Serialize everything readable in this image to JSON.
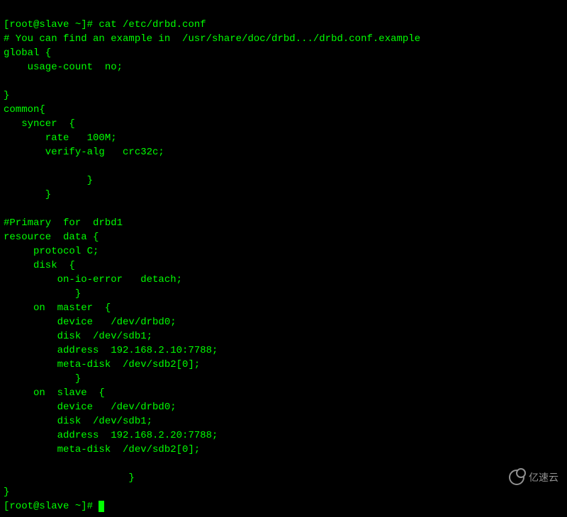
{
  "terminal": {
    "prompt1": "[root@slave ~]# ",
    "command1": "cat /etc/drbd.conf",
    "lines": [
      "# You can find an example in  /usr/share/doc/drbd.../drbd.conf.example",
      "global {",
      "    usage-count  no;",
      "",
      "}",
      "common{",
      "   syncer  {",
      "       rate   100M;",
      "       verify-alg   crc32c;",
      "",
      "              }",
      "       }",
      "",
      "#Primary  for  drbd1",
      "resource  data {",
      "     protocol C;",
      "     disk  {",
      "         on-io-error   detach;",
      "            }",
      "     on  master  {",
      "         device   /dev/drbd0;",
      "         disk  /dev/sdb1;",
      "         address  192.168.2.10:7788;",
      "         meta-disk  /dev/sdb2[0];",
      "            }",
      "     on  slave  {",
      "         device   /dev/drbd0;",
      "         disk  /dev/sdb1;",
      "         address  192.168.2.20:7788;",
      "         meta-disk  /dev/sdb2[0];",
      "",
      "                     }",
      "}"
    ],
    "prompt2": "[root@slave ~]# "
  },
  "watermark": {
    "text": "亿速云"
  }
}
